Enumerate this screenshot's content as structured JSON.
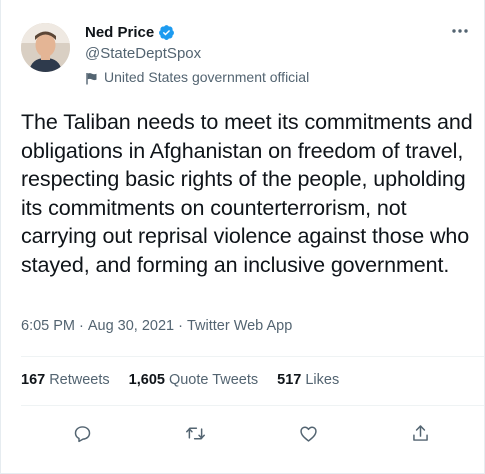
{
  "user": {
    "display_name": "Ned Price",
    "handle": "@StateDeptSpox",
    "label": "United States government official",
    "verified_icon": "verified-badge-icon",
    "flag_icon": "flag-icon"
  },
  "tweet": {
    "text": "The Taliban needs to meet its commitments and obligations in Afghanistan on freedom of travel, respecting basic rights of the people, upholding its commitments on counterterrorism, not carrying out reprisal violence against those who stayed, and forming an inclusive government.",
    "time": "6:05 PM",
    "separator": "·",
    "date": "Aug 30, 2021",
    "source": "Twitter Web App"
  },
  "stats": {
    "retweets_count": "167",
    "retweets_label": "Retweets",
    "quotes_count": "1,605",
    "quotes_label": "Quote Tweets",
    "likes_count": "517",
    "likes_label": "Likes"
  },
  "colors": {
    "primary_text": "#0f1419",
    "secondary_text": "#536471",
    "verified_blue": "#1d9bf0",
    "divider": "#eff3f4"
  },
  "actions": [
    "reply-icon",
    "retweet-icon",
    "like-icon",
    "share-icon"
  ]
}
